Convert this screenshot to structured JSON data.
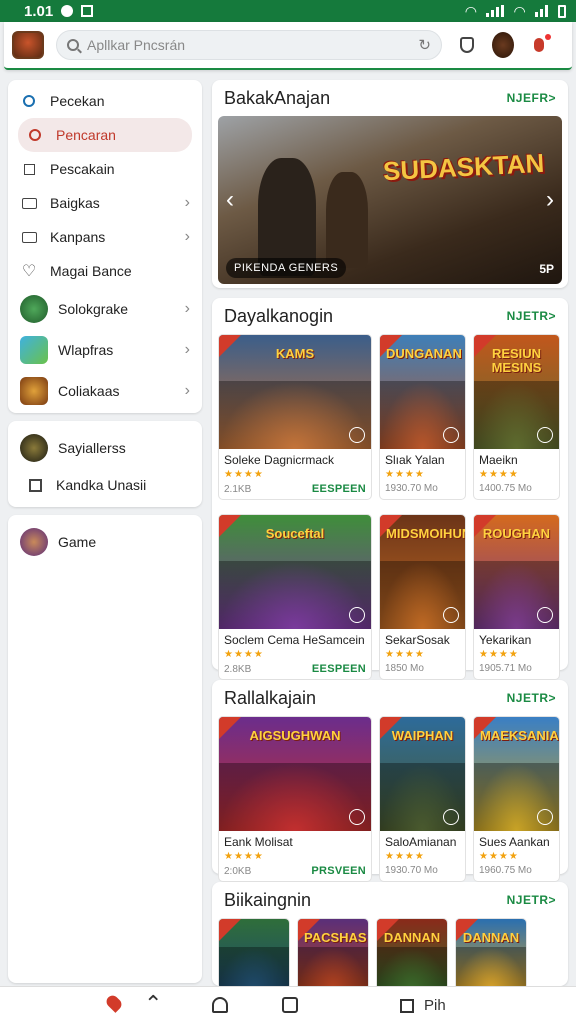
{
  "status_bar": {
    "time": "1.01"
  },
  "search": {
    "placeholder": "Apllkar Pncsrán"
  },
  "sidebar": {
    "section1": [
      {
        "label": "Pecekan",
        "icon": "search-icon"
      },
      {
        "label": "Pencaran",
        "icon": "search-icon",
        "active": true
      },
      {
        "label": "Pescakain",
        "icon": "square-icon"
      },
      {
        "label": "Baigkas",
        "icon": "tv-icon"
      },
      {
        "label": "Kanpans",
        "icon": "tv-icon"
      },
      {
        "label": "Magai Bance",
        "icon": "heart-icon"
      },
      {
        "label": "Solokgrake"
      },
      {
        "label": "Wlapfras"
      },
      {
        "label": "Coliakaas"
      }
    ],
    "section2": [
      {
        "label": "Sayiallerss"
      },
      {
        "label": "Kandka Unasii",
        "icon": "square-icon"
      }
    ],
    "section3": [
      {
        "label": "Game"
      }
    ]
  },
  "featured": {
    "title": "BakakAnajan",
    "more": "NJEFR>",
    "banner_title": "SUDASKTAN",
    "banner_chip": "PIKENDA GENERS",
    "banner_corner": "5P"
  },
  "sections": [
    {
      "title": "Dayalkanogin",
      "more": "NJETR>",
      "games": [
        {
          "name": "Solekе Dagnicrmack",
          "size": "2.1KB",
          "price": "EESPEEN",
          "art_text": "KAMS",
          "colors": [
            "#3b5e8a",
            "#c4743a"
          ]
        },
        {
          "name": "Slıak Yalan",
          "size": "1930.70 Mo",
          "price": "",
          "art_text": "DUNGANAN",
          "colors": [
            "#3e7fb8",
            "#b8562a"
          ]
        },
        {
          "name": "Maeikn",
          "size": "1400.75 Mo",
          "price": "",
          "art_text": "RESIUN MESINS",
          "colors": [
            "#c2571c",
            "#5e6c2f"
          ]
        }
      ]
    },
    {
      "title": "",
      "more": "",
      "games": [
        {
          "name": "Soclem Cema HeSamcein",
          "size": "2.8KB",
          "price": "EESPEEN",
          "art_text": "Souceftal",
          "colors": [
            "#3f8e3a",
            "#7a3a9c"
          ]
        },
        {
          "name": "SekarSosak",
          "size": "1850 Mo",
          "price": "",
          "art_text": "MIDSMOIHUNDOMNIS",
          "colors": [
            "#6b3418",
            "#c06a24"
          ]
        },
        {
          "name": "Yekarikan",
          "size": "1905.71 Mo",
          "price": "",
          "art_text": "ROUGHAN",
          "colors": [
            "#d46a1e",
            "#7a3b8c"
          ]
        }
      ]
    },
    {
      "title": "Rallalkajain",
      "more": "NJETR>",
      "games": [
        {
          "name": "Eank Molisat",
          "size": "2:0KB",
          "price": "PRSVEEN",
          "art_text": "AIGSUGHWAN",
          "colors": [
            "#6b2d8c",
            "#c22f2f"
          ]
        },
        {
          "name": "SaloAmianan",
          "size": "1930.70 Mo",
          "price": "",
          "art_text": "WAIPHAN",
          "colors": [
            "#2d6b9a",
            "#4a5a2e"
          ]
        },
        {
          "name": "Sues Aankan",
          "size": "1960.75 Mo",
          "price": "",
          "art_text": "MAEKSANIAN",
          "colors": [
            "#3a7fc4",
            "#c9a326"
          ]
        }
      ]
    },
    {
      "title": "Biikaingnin",
      "more": "NJETR>",
      "games": [
        {
          "name": "",
          "size": "",
          "price": "",
          "art_text": "",
          "colors": [
            "#2f6e3a",
            "#1f4a6b"
          ]
        },
        {
          "name": "",
          "size": "",
          "price": "",
          "art_text": "PACSHAS",
          "colors": [
            "#5a2f7a",
            "#b3421f"
          ]
        },
        {
          "name": "",
          "size": "",
          "price": "",
          "art_text": "DANNAN",
          "colors": [
            "#8a2a1a",
            "#3a6a2a"
          ]
        },
        {
          "name": "",
          "size": "",
          "price": "",
          "art_text": "DANNAN",
          "colors": [
            "#2a6fb0",
            "#d6a12a"
          ]
        }
      ]
    }
  ],
  "bottom_nav": {
    "label": "Pih"
  },
  "colors": {
    "accent": "#1a8a43",
    "status_bar": "#157a3c",
    "active": "#c0392b",
    "stars": "#f2a20f"
  }
}
